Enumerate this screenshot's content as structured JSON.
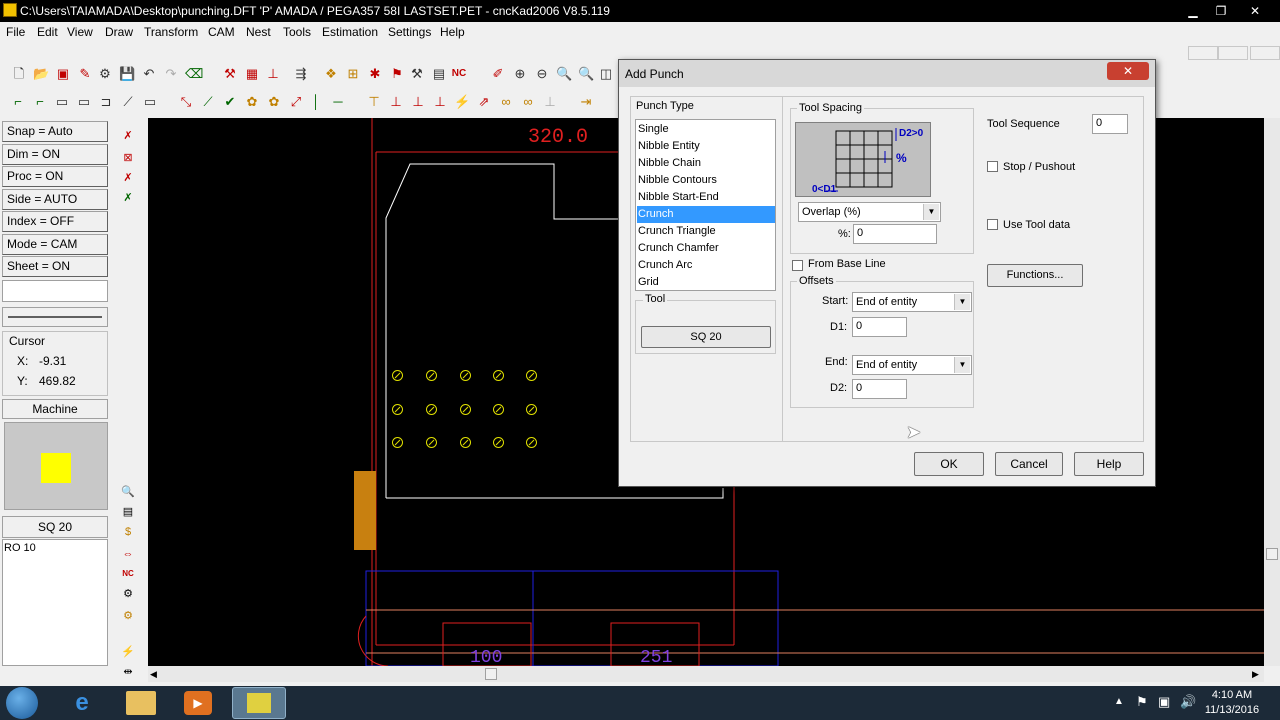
{
  "window": {
    "title": "C:\\Users\\TAIAMADA\\Desktop\\punching.DFT  'P'  AMADA / PEGA357   58I   LASTSET.PET - cncKad2006 V8.5.119"
  },
  "menu": [
    "File",
    "Edit",
    "View",
    "Draw",
    "Transform",
    "CAM",
    "Nest",
    "Tools",
    "Estimation",
    "Settings",
    "Help"
  ],
  "status_buttons": [
    "Snap = Auto",
    "Dim   = ON",
    "Proc  = ON",
    "Side  = AUTO",
    "Index = OFF",
    "Mode = CAM",
    "Sheet = ON"
  ],
  "cursor": {
    "label": "Cursor",
    "x_label": "X:",
    "x": "-9.31",
    "y_label": "Y:",
    "y": "469.82"
  },
  "machine": {
    "label": "Machine",
    "color": "#ffff00"
  },
  "tools": {
    "current": "SQ 20",
    "list": [
      "RO 10"
    ]
  },
  "canvas": {
    "dim_top": "320.0",
    "dim_bottom_1": "100",
    "dim_bottom_2": "251"
  },
  "dialog": {
    "title": "Add Punch",
    "punch_type_label": "Punch Type",
    "punch_types": [
      "Single",
      "Nibble Entity",
      "Nibble Chain",
      "Nibble Contours",
      "Nibble Start-End",
      "Crunch",
      "Crunch Triangle",
      "Crunch Chamfer",
      "Crunch Arc",
      "Grid"
    ],
    "selected_punch_type": "Crunch",
    "tool_label": "Tool",
    "tool_value": "SQ 20",
    "tool_spacing_label": "Tool Spacing",
    "diagram": {
      "d2": "D2>0",
      "pct": "%",
      "d1": "0<D1"
    },
    "spacing_mode": "Overlap (%)",
    "pct_label": "%:",
    "pct_value": "0",
    "from_base_line_label": "From Base Line",
    "offsets_label": "Offsets",
    "start_label": "Start:",
    "start_value": "End of entity",
    "d1_label": "D1:",
    "d1_value": "0",
    "end_label": "End:",
    "end_value": "End of entity",
    "d2_label": "D2:",
    "d2_value": "0",
    "tool_sequence_label": "Tool Sequence",
    "tool_sequence_value": "0",
    "stop_pushout_label": "Stop / Pushout",
    "use_tool_data_label": "Use Tool data",
    "functions_label": "Functions...",
    "ok_label": "OK",
    "cancel_label": "Cancel",
    "help_label": "Help",
    "close_glyph": "✕"
  },
  "taskbar": {
    "time": "4:10 AM",
    "date": "11/13/2016"
  },
  "colors": {
    "accent": "#3399ff",
    "canvas": "#000000",
    "dim_red": "#e02020",
    "hole": "#e0e000",
    "clamp": "#c88010"
  }
}
